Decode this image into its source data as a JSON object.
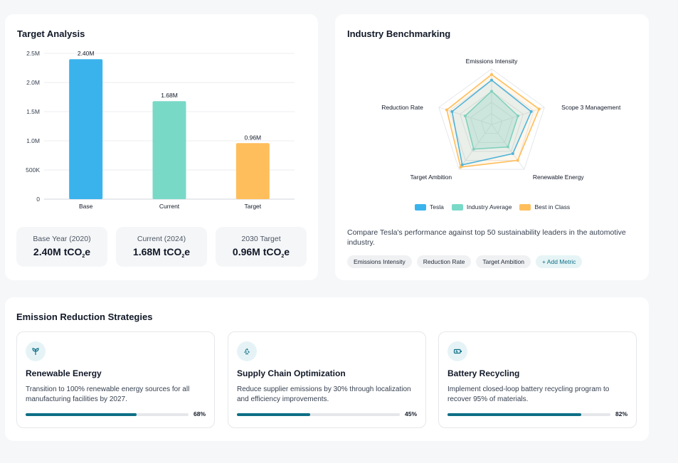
{
  "target_analysis": {
    "title": "Target Analysis",
    "chart_data": {
      "type": "bar",
      "categories": [
        "Base",
        "Current",
        "Target"
      ],
      "values": [
        2.4,
        1.68,
        0.96
      ],
      "data_labels": [
        "2.40M",
        "1.68M",
        "0.96M"
      ],
      "colors": [
        "#3ab3ec",
        "#79d9c7",
        "#ffbe5c"
      ],
      "ylim": [
        0,
        2.5
      ],
      "yticks": [
        "0",
        "500K",
        "1.0M",
        "1.5M",
        "2.0M",
        "2.5M"
      ],
      "ytick_values": [
        0,
        0.5,
        1.0,
        1.5,
        2.0,
        2.5
      ],
      "grid": true
    },
    "stats": [
      {
        "label": "Base Year (2020)",
        "value": "2.40M tCO",
        "sub": "2",
        "suffix": "e"
      },
      {
        "label": "Current (2024)",
        "value": "1.68M tCO",
        "sub": "2",
        "suffix": "e"
      },
      {
        "label": "2030 Target",
        "value": "0.96M tCO",
        "sub": "2",
        "suffix": "e"
      }
    ]
  },
  "benchmarking": {
    "title": "Industry Benchmarking",
    "chart_data": {
      "type": "radar",
      "axes": [
        "Emissions Intensity",
        "Scope 3 Management",
        "Renewable Energy",
        "Target Ambition",
        "Reduction Rate"
      ],
      "rmax": 100,
      "series": [
        {
          "name": "Tesla",
          "color": "#3ab3ec",
          "values": [
            80,
            75,
            65,
            90,
            75
          ]
        },
        {
          "name": "Industry Average",
          "color": "#79d9c7",
          "values": [
            60,
            50,
            50,
            55,
            50
          ]
        },
        {
          "name": "Best in Class",
          "color": "#ffbe5c",
          "values": [
            90,
            90,
            80,
            95,
            85
          ]
        }
      ]
    },
    "legend": [
      "Tesla",
      "Industry Average",
      "Best in Class"
    ],
    "description": "Compare Tesla's performance against top 50 sustainability leaders in the automotive industry.",
    "chips": [
      "Emissions Intensity",
      "Reduction Rate",
      "Target Ambition"
    ],
    "add_metric": "+ Add Metric"
  },
  "strategies": {
    "title": "Emission Reduction Strategies",
    "items": [
      {
        "icon": "plant-icon",
        "title": "Renewable Energy",
        "description": "Transition to 100% renewable energy sources for all manufacturing facilities by 2027.",
        "progress": 0.68,
        "progress_label": "68%"
      },
      {
        "icon": "recycle-icon",
        "title": "Supply Chain Optimization",
        "description": "Reduce supplier emissions by 30% through localization and efficiency improvements.",
        "progress": 0.45,
        "progress_label": "45%"
      },
      {
        "icon": "battery-icon",
        "title": "Battery Recycling",
        "description": "Implement closed-loop battery recycling program to recover 95% of materials.",
        "progress": 0.82,
        "progress_label": "82%"
      }
    ]
  },
  "colors": {
    "accent": "#0e6f86",
    "card_bg": "#ffffff",
    "page_bg": "#f6f7f9"
  }
}
